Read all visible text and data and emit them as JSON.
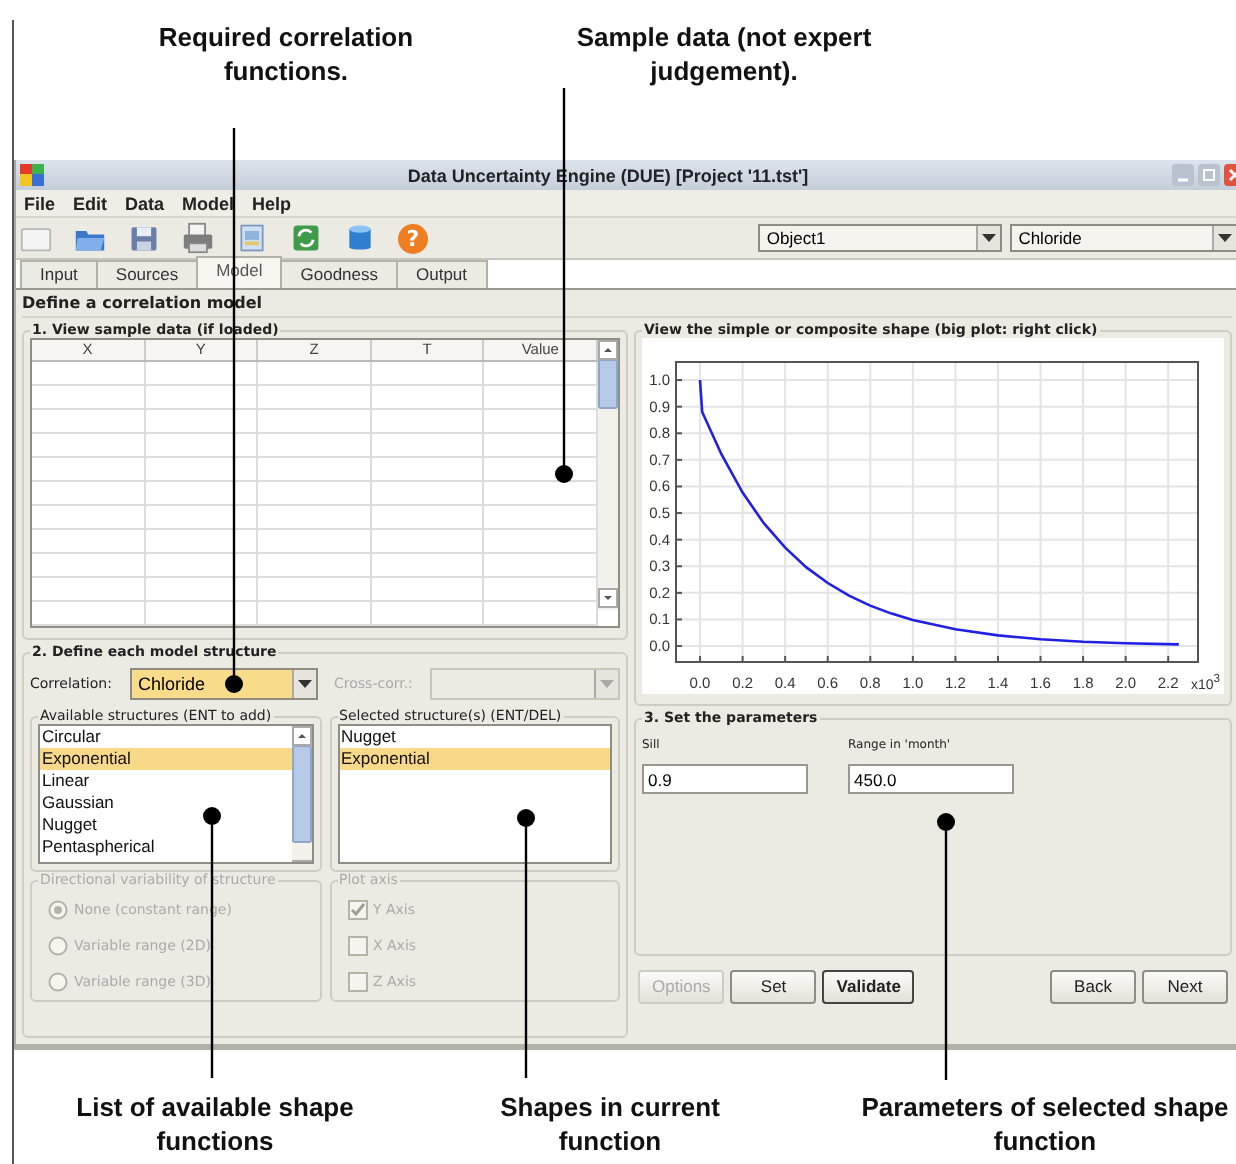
{
  "annotations": {
    "top": [
      {
        "text": "Required correlation functions."
      },
      {
        "text": "Sample data (not expert judgement)."
      }
    ],
    "bottom": [
      {
        "text": "List of available shape functions"
      },
      {
        "text": "Shapes in current function"
      },
      {
        "text": "Parameters of selected shape function"
      }
    ]
  },
  "window": {
    "title": "Data Uncertainty Engine (DUE)  [Project '11.tst']"
  },
  "menu": [
    "File",
    "Edit",
    "Data",
    "Model",
    "Help"
  ],
  "toolbar": {
    "buttons": [
      {
        "kind": "new"
      },
      {
        "kind": "open"
      },
      {
        "kind": "save"
      },
      {
        "kind": "print"
      },
      {
        "kind": "image"
      },
      {
        "kind": "refresh"
      },
      {
        "kind": "database"
      },
      {
        "kind": "help",
        "glyph": "?"
      }
    ],
    "object_select": {
      "value": "Object1"
    },
    "attribute_select": {
      "value": "Chloride"
    }
  },
  "tabs": [
    {
      "label": "Input",
      "selected": false
    },
    {
      "label": "Sources",
      "selected": false
    },
    {
      "label": "Model",
      "selected": true
    },
    {
      "label": "Goodness",
      "selected": false
    },
    {
      "label": "Output",
      "selected": false
    }
  ],
  "page_title": "Define a correlation model",
  "sample_data": {
    "title": "1. View sample data (if loaded)",
    "columns": [
      "X",
      "Y",
      "Z",
      "T",
      "Value"
    ]
  },
  "model_structure": {
    "title": "2. Define each model structure",
    "correlation": {
      "label": "Correlation:",
      "value": "Chloride"
    },
    "cross_correlation": {
      "label": "Cross-corr.:",
      "disabled": true
    },
    "available": {
      "title": "Available structures (ENT to add)",
      "items": [
        {
          "label": "Circular",
          "selected": false
        },
        {
          "label": "Exponential",
          "selected": true
        },
        {
          "label": "Linear",
          "selected": false
        },
        {
          "label": "Gaussian",
          "selected": false
        },
        {
          "label": "Nugget",
          "selected": false
        },
        {
          "label": "Pentaspherical",
          "selected": false
        }
      ]
    },
    "selected": {
      "title": "Selected structure(s) (ENT/DEL)",
      "items": [
        {
          "label": "Nugget",
          "selected": false
        },
        {
          "label": "Exponential",
          "selected": true
        }
      ]
    },
    "directional": {
      "title": "Directional variability of structure",
      "disabled": true,
      "options": [
        {
          "label": "None (constant range)",
          "selected": true
        },
        {
          "label": "Variable range (2D)",
          "selected": false
        },
        {
          "label": "Variable range (3D)",
          "selected": false
        }
      ]
    },
    "plot_axis": {
      "title": "Plot axis",
      "disabled": true,
      "options": [
        {
          "label": "Y Axis",
          "checked": true
        },
        {
          "label": "X Axis",
          "checked": false
        },
        {
          "label": "Z Axis",
          "checked": false
        }
      ]
    }
  },
  "shape_view": {
    "title": "View the simple or composite shape (big plot: right click)",
    "chart_data": {
      "type": "line",
      "xlabel": "x10$^{3}$",
      "x": [
        0,
        0.01,
        0.1,
        0.2,
        0.3,
        0.4,
        0.5,
        0.6,
        0.7,
        0.8,
        0.9,
        1.0,
        1.2,
        1.4,
        1.6,
        1.8,
        2.0,
        2.25
      ],
      "grid": true,
      "series": [
        {
          "color": "#1f1fe6",
          "values": [
            1.0,
            0.88,
            0.721,
            0.577,
            0.462,
            0.37,
            0.296,
            0.237,
            0.19,
            0.152,
            0.122,
            0.098,
            0.063,
            0.04,
            0.026,
            0.016,
            0.011,
            0.006
          ]
        }
      ],
      "xlim": [
        -0.113,
        2.34
      ],
      "ylim": [
        -0.06,
        1.068
      ],
      "xticks": [
        {
          "value": 0,
          "label": "0.0"
        },
        {
          "value": 0.2,
          "label": "0.2"
        },
        {
          "value": 0.4,
          "label": "0.4"
        },
        {
          "value": 0.6,
          "label": "0.6"
        },
        {
          "value": 0.8,
          "label": "0.8"
        },
        {
          "value": 1.0,
          "label": "1.0"
        },
        {
          "value": 1.2,
          "label": "1.2"
        },
        {
          "value": 1.4,
          "label": "1.4"
        },
        {
          "value": 1.6,
          "label": "1.6"
        },
        {
          "value": 1.8,
          "label": "1.8"
        },
        {
          "value": 2.0,
          "label": "2.0"
        },
        {
          "value": 2.2,
          "label": "2.2"
        }
      ],
      "yticks": [
        {
          "value": 0,
          "label": "0.0"
        },
        {
          "value": 0.1,
          "label": "0.1"
        },
        {
          "value": 0.2,
          "label": "0.2"
        },
        {
          "value": 0.3,
          "label": "0.3"
        },
        {
          "value": 0.4,
          "label": "0.4"
        },
        {
          "value": 0.5,
          "label": "0.5"
        },
        {
          "value": 0.6,
          "label": "0.6"
        },
        {
          "value": 0.7,
          "label": "0.7"
        },
        {
          "value": 0.8,
          "label": "0.8"
        },
        {
          "value": 0.9,
          "label": "0.9"
        },
        {
          "value": 1.0,
          "label": "1.0"
        }
      ]
    }
  },
  "parameters": {
    "title": "3. Set the parameters",
    "fields": [
      {
        "label": "Sill",
        "value": "0.9"
      },
      {
        "label": "Range in 'month'",
        "value": "450.0"
      }
    ]
  },
  "buttons": {
    "left": [
      {
        "label": "Options",
        "disabled": true,
        "default": false
      },
      {
        "label": "Set",
        "disabled": false,
        "default": false
      },
      {
        "label": "Validate",
        "disabled": false,
        "default": true
      }
    ],
    "right": [
      {
        "label": "Back",
        "disabled": false,
        "default": false
      },
      {
        "label": "Next",
        "disabled": false,
        "default": false
      }
    ]
  }
}
